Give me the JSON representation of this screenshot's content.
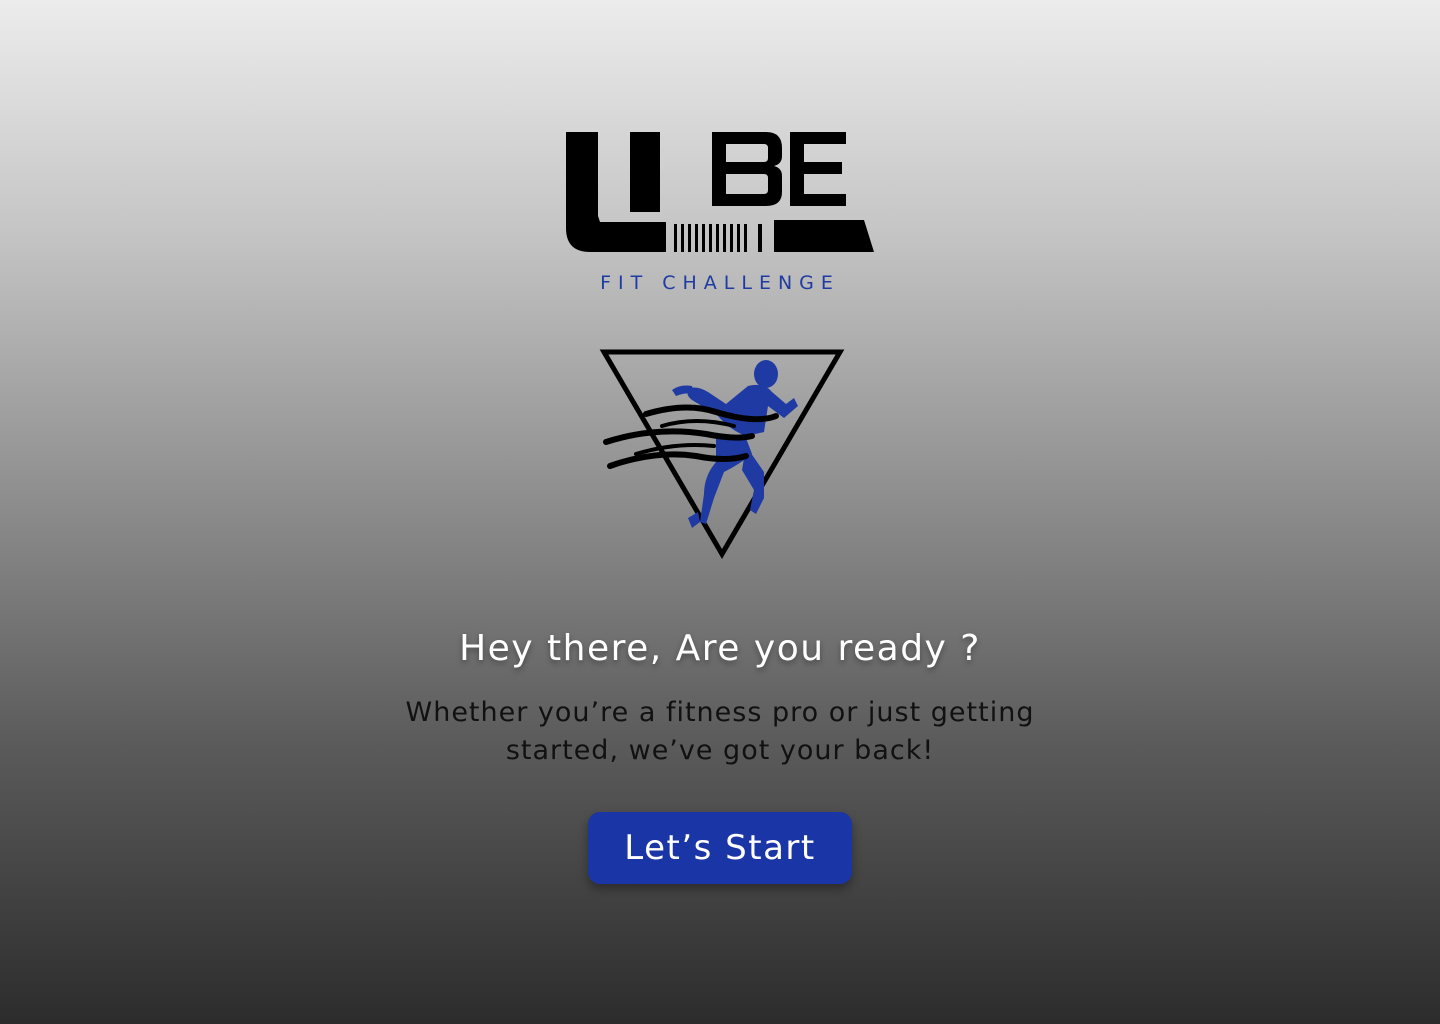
{
  "brand": {
    "wordmark": "UBE",
    "tagline": "FIT CHALLENGE",
    "accent_color": "#1f3ba3",
    "logo_icon": "ube-wordmark-logo",
    "emblem_icon": "runner-triangle-emblem"
  },
  "welcome": {
    "headline": "Hey there, Are you ready ?",
    "subline": "Whether you’re a fitness pro or just getting started, we’ve got your back!"
  },
  "actions": {
    "start_label": "Let’s Start",
    "start_color": "#1a35a6"
  }
}
